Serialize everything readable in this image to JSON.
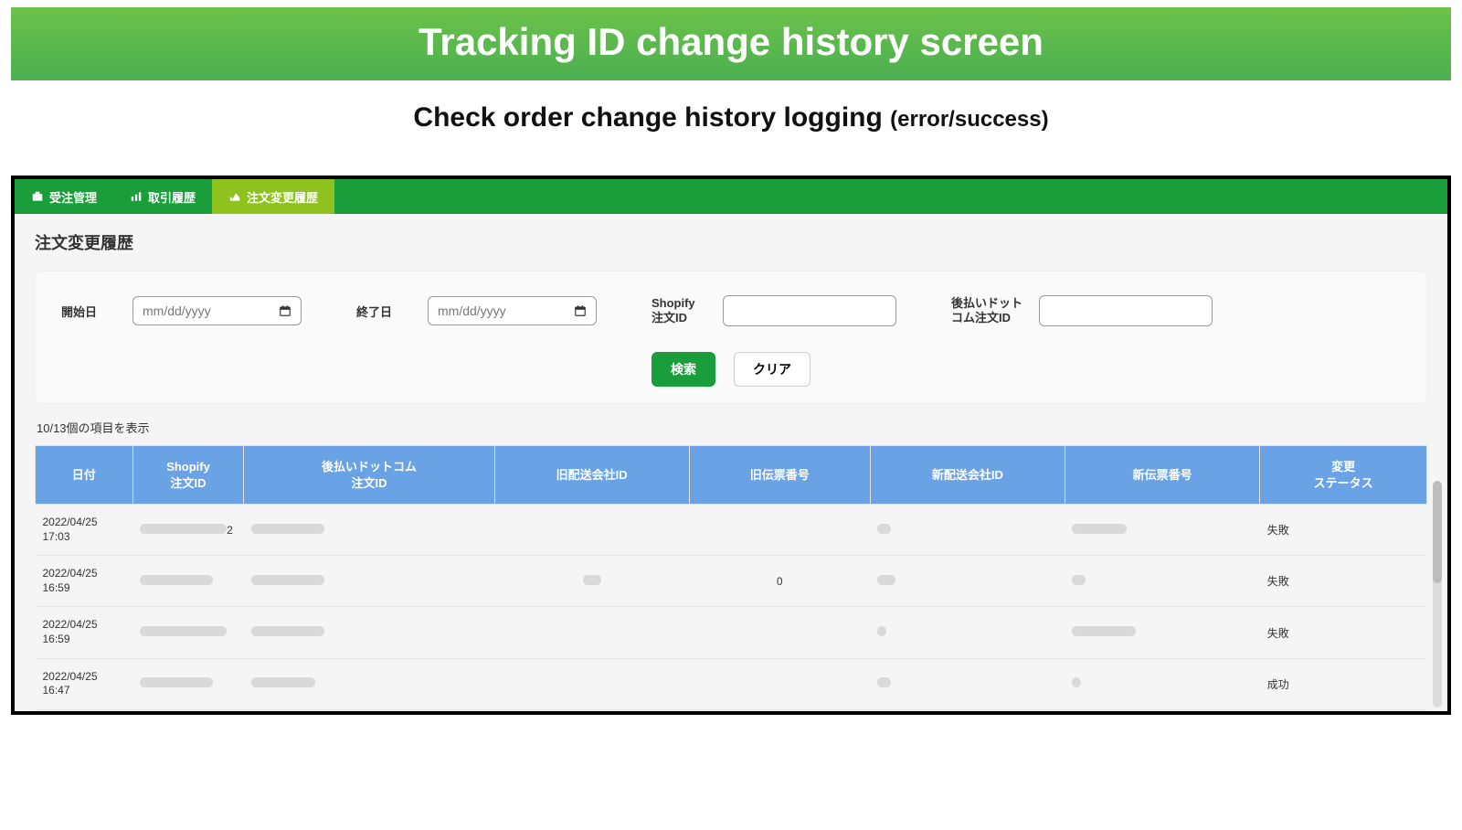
{
  "banner": {
    "title": "Tracking ID change history screen"
  },
  "subtitle": {
    "main": "Check order change history logging ",
    "paren": "(error/success)"
  },
  "nav": {
    "items": [
      {
        "label": "受注管理",
        "active": false
      },
      {
        "label": "取引履歴",
        "active": false
      },
      {
        "label": "注文変更履歴",
        "active": true
      }
    ]
  },
  "page": {
    "title": "注文変更履歴"
  },
  "filters": {
    "start_label": "開始日",
    "end_label": "終了日",
    "shopify_label_l1": "Shopify",
    "shopify_label_l2": "注文ID",
    "atobarai_label_l1": "後払いドット",
    "atobarai_label_l2": "コム注文ID",
    "date_placeholder": "mm/dd/yyyy",
    "search_btn": "検索",
    "clear_btn": "クリア"
  },
  "count_text": "10/13個の項目を表示",
  "table": {
    "headers": {
      "date": "日付",
      "shopify_id_l1": "Shopify",
      "shopify_id_l2": "注文ID",
      "atobarai_id_l1": "後払いドットコム",
      "atobarai_id_l2": "注文ID",
      "old_carrier": "旧配送会社ID",
      "old_slip": "旧伝票番号",
      "new_carrier": "新配送会社ID",
      "new_slip": "新伝票番号",
      "status_l1": "変更",
      "status_l2": "ステータス"
    },
    "rows": [
      {
        "date": "2022/04/25 17:03",
        "shopify_suffix": "2",
        "old_slip": "",
        "status": "失敗"
      },
      {
        "date": "2022/04/25 16:59",
        "shopify_suffix": "",
        "old_slip": "0",
        "status": "失敗"
      },
      {
        "date": "2022/04/25 16:59",
        "shopify_suffix": "",
        "old_slip": "",
        "status": "失敗"
      },
      {
        "date": "2022/04/25 16:47",
        "shopify_suffix": "",
        "old_slip": "",
        "status": "成功"
      }
    ]
  }
}
